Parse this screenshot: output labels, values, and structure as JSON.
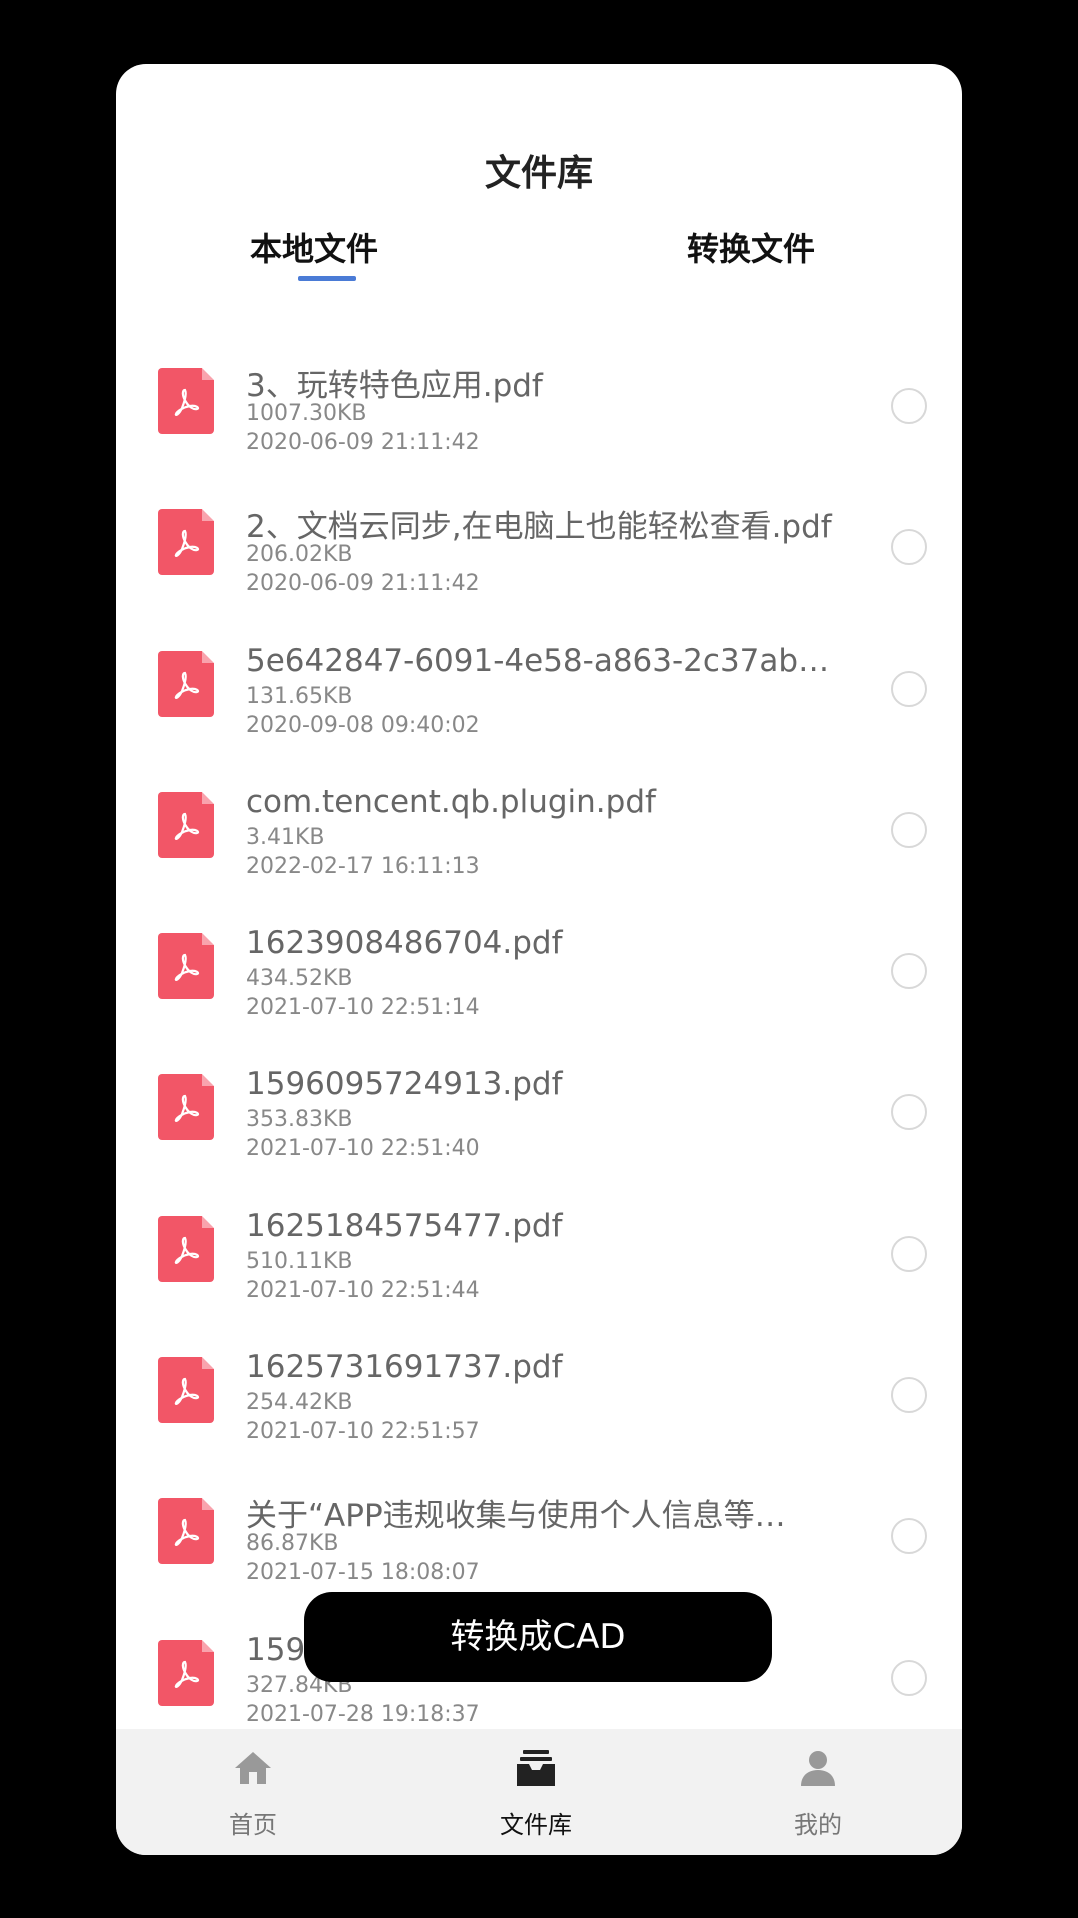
{
  "header": {
    "title": "文件库"
  },
  "tabs": [
    {
      "label": "本地文件",
      "active": true
    },
    {
      "label": "转换文件",
      "active": false
    }
  ],
  "files": [
    {
      "name": "3、玩转特色应用.pdf",
      "size": "1007.30KB",
      "date": "2020-06-09 21:11:42",
      "icon": "pdf-icon"
    },
    {
      "name": "2、文档云同步,在电脑上也能轻松查看.pdf",
      "size": "206.02KB",
      "date": "2020-06-09 21:11:42",
      "icon": "pdf-icon"
    },
    {
      "name": "5e642847-6091-4e58-a863-2c37ab…",
      "size": "131.65KB",
      "date": "2020-09-08 09:40:02",
      "icon": "pdf-icon"
    },
    {
      "name": "com.tencent.qb.plugin.pdf",
      "size": "3.41KB",
      "date": "2022-02-17 16:11:13",
      "icon": "pdf-icon"
    },
    {
      "name": "1623908486704.pdf",
      "size": "434.52KB",
      "date": "2021-07-10 22:51:14",
      "icon": "pdf-icon"
    },
    {
      "name": "1596095724913.pdf",
      "size": "353.83KB",
      "date": "2021-07-10 22:51:40",
      "icon": "pdf-icon"
    },
    {
      "name": "1625184575477.pdf",
      "size": "510.11KB",
      "date": "2021-07-10 22:51:44",
      "icon": "pdf-icon"
    },
    {
      "name": "1625731691737.pdf",
      "size": "254.42KB",
      "date": "2021-07-10 22:51:57",
      "icon": "pdf-icon"
    },
    {
      "name": "关于“APP违规收集与使用个人信息等…",
      "size": "86.87KB",
      "date": "2021-07-15 18:08:07",
      "icon": "pdf-icon"
    },
    {
      "name": "159",
      "size": "327.84KB",
      "date": "2021-07-28 19:18:37",
      "icon": "pdf-icon"
    }
  ],
  "action": {
    "convert_label": "转换成CAD"
  },
  "bottom_nav": [
    {
      "label": "首页",
      "icon": "home-icon",
      "active": false
    },
    {
      "label": "文件库",
      "icon": "inbox-icon",
      "active": true
    },
    {
      "label": "我的",
      "icon": "user-icon",
      "active": false
    }
  ],
  "colors": {
    "accent": "#4a7bd6",
    "pdf": "#f25667",
    "nav_bg": "#f2f2f2"
  }
}
